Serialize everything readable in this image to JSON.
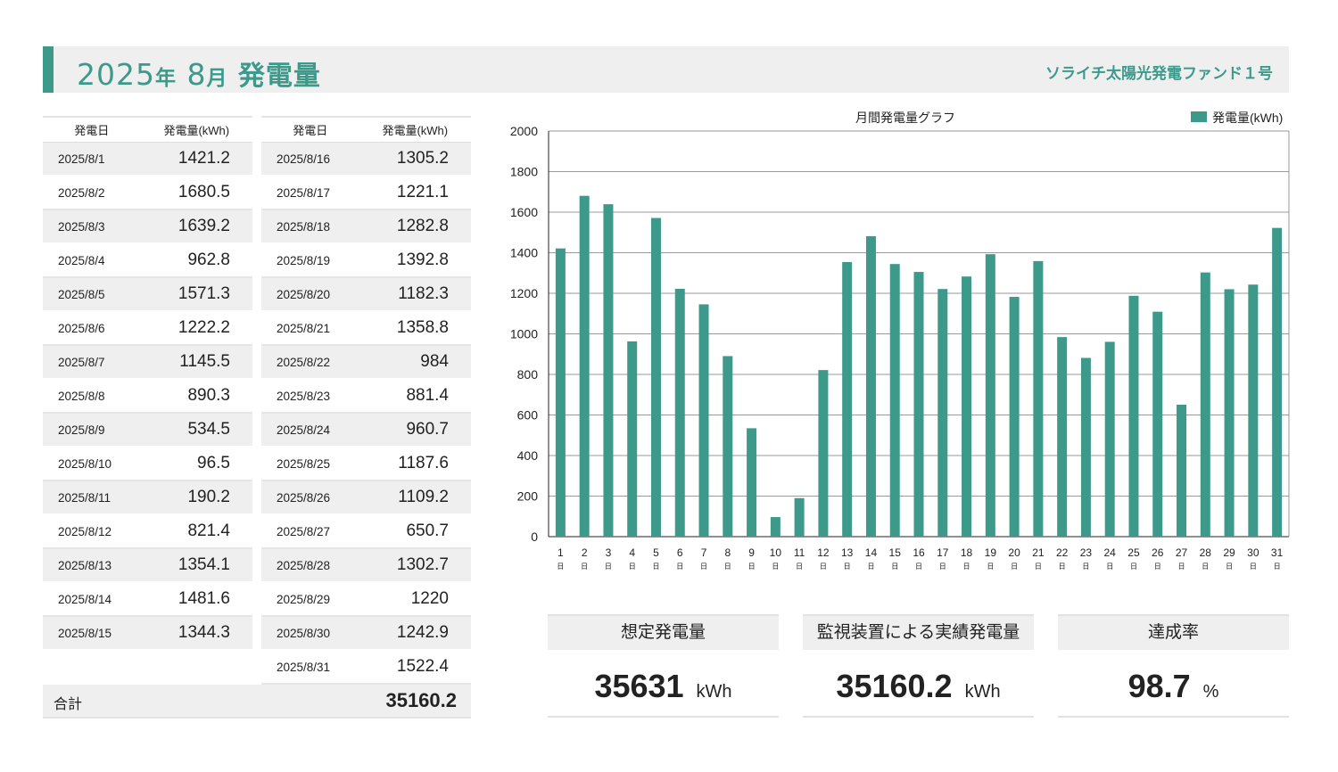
{
  "header": {
    "year": "2025",
    "year_suffix": "年",
    "month": "8",
    "month_suffix": "月",
    "label": "発電量",
    "fund": "ソライチ太陽光発電ファンド１号"
  },
  "table": {
    "col_date": "発電日",
    "col_value": "発電量(kWh)",
    "left": [
      {
        "date": "2025/8/1",
        "value": "1421.2"
      },
      {
        "date": "2025/8/2",
        "value": "1680.5"
      },
      {
        "date": "2025/8/3",
        "value": "1639.2"
      },
      {
        "date": "2025/8/4",
        "value": "962.8"
      },
      {
        "date": "2025/8/5",
        "value": "1571.3"
      },
      {
        "date": "2025/8/6",
        "value": "1222.2"
      },
      {
        "date": "2025/8/7",
        "value": "1145.5"
      },
      {
        "date": "2025/8/8",
        "value": "890.3"
      },
      {
        "date": "2025/8/9",
        "value": "534.5"
      },
      {
        "date": "2025/8/10",
        "value": "96.5"
      },
      {
        "date": "2025/8/11",
        "value": "190.2"
      },
      {
        "date": "2025/8/12",
        "value": "821.4"
      },
      {
        "date": "2025/8/13",
        "value": "1354.1"
      },
      {
        "date": "2025/8/14",
        "value": "1481.6"
      },
      {
        "date": "2025/8/15",
        "value": "1344.3"
      }
    ],
    "right": [
      {
        "date": "2025/8/16",
        "value": "1305.2"
      },
      {
        "date": "2025/8/17",
        "value": "1221.1"
      },
      {
        "date": "2025/8/18",
        "value": "1282.8"
      },
      {
        "date": "2025/8/19",
        "value": "1392.8"
      },
      {
        "date": "2025/8/20",
        "value": "1182.3"
      },
      {
        "date": "2025/8/21",
        "value": "1358.8"
      },
      {
        "date": "2025/8/22",
        "value": "984"
      },
      {
        "date": "2025/8/23",
        "value": "881.4"
      },
      {
        "date": "2025/8/24",
        "value": "960.7"
      },
      {
        "date": "2025/8/25",
        "value": "1187.6"
      },
      {
        "date": "2025/8/26",
        "value": "1109.2"
      },
      {
        "date": "2025/8/27",
        "value": "650.7"
      },
      {
        "date": "2025/8/28",
        "value": "1302.7"
      },
      {
        "date": "2025/8/29",
        "value": "1220"
      },
      {
        "date": "2025/8/30",
        "value": "1242.9"
      },
      {
        "date": "2025/8/31",
        "value": "1522.4"
      }
    ],
    "total_label": "合計",
    "total_value": "35160.2"
  },
  "kpis": [
    {
      "label": "想定発電量",
      "value": "35631",
      "unit": "kWh"
    },
    {
      "label": "監視装置による実績発電量",
      "value": "35160.2",
      "unit": "kWh"
    },
    {
      "label": "達成率",
      "value": "98.7",
      "unit": "%"
    }
  ],
  "chart_data": {
    "type": "bar",
    "title": "月間発電量グラフ",
    "legend_position": "top-right",
    "bar_color": "#3d9a8b",
    "categories": [
      "1",
      "2",
      "3",
      "4",
      "5",
      "6",
      "7",
      "8",
      "9",
      "10",
      "11",
      "12",
      "13",
      "14",
      "15",
      "16",
      "17",
      "18",
      "19",
      "20",
      "21",
      "22",
      "23",
      "24",
      "25",
      "26",
      "27",
      "28",
      "29",
      "30",
      "31"
    ],
    "category_suffix": "日",
    "series": [
      {
        "name": "発電量(kWh)",
        "values": [
          1421.2,
          1680.5,
          1639.2,
          962.8,
          1571.3,
          1222.2,
          1145.5,
          890.3,
          534.5,
          96.5,
          190.2,
          821.4,
          1354.1,
          1481.6,
          1344.3,
          1305.2,
          1221.1,
          1282.8,
          1392.8,
          1182.3,
          1358.8,
          984,
          881.4,
          960.7,
          1187.6,
          1109.2,
          650.7,
          1302.7,
          1220,
          1242.9,
          1522.4
        ]
      }
    ],
    "ylim": [
      0,
      2000
    ],
    "yticks": [
      0,
      200,
      400,
      600,
      800,
      1000,
      1200,
      1400,
      1600,
      1800,
      2000
    ],
    "grid": true
  }
}
